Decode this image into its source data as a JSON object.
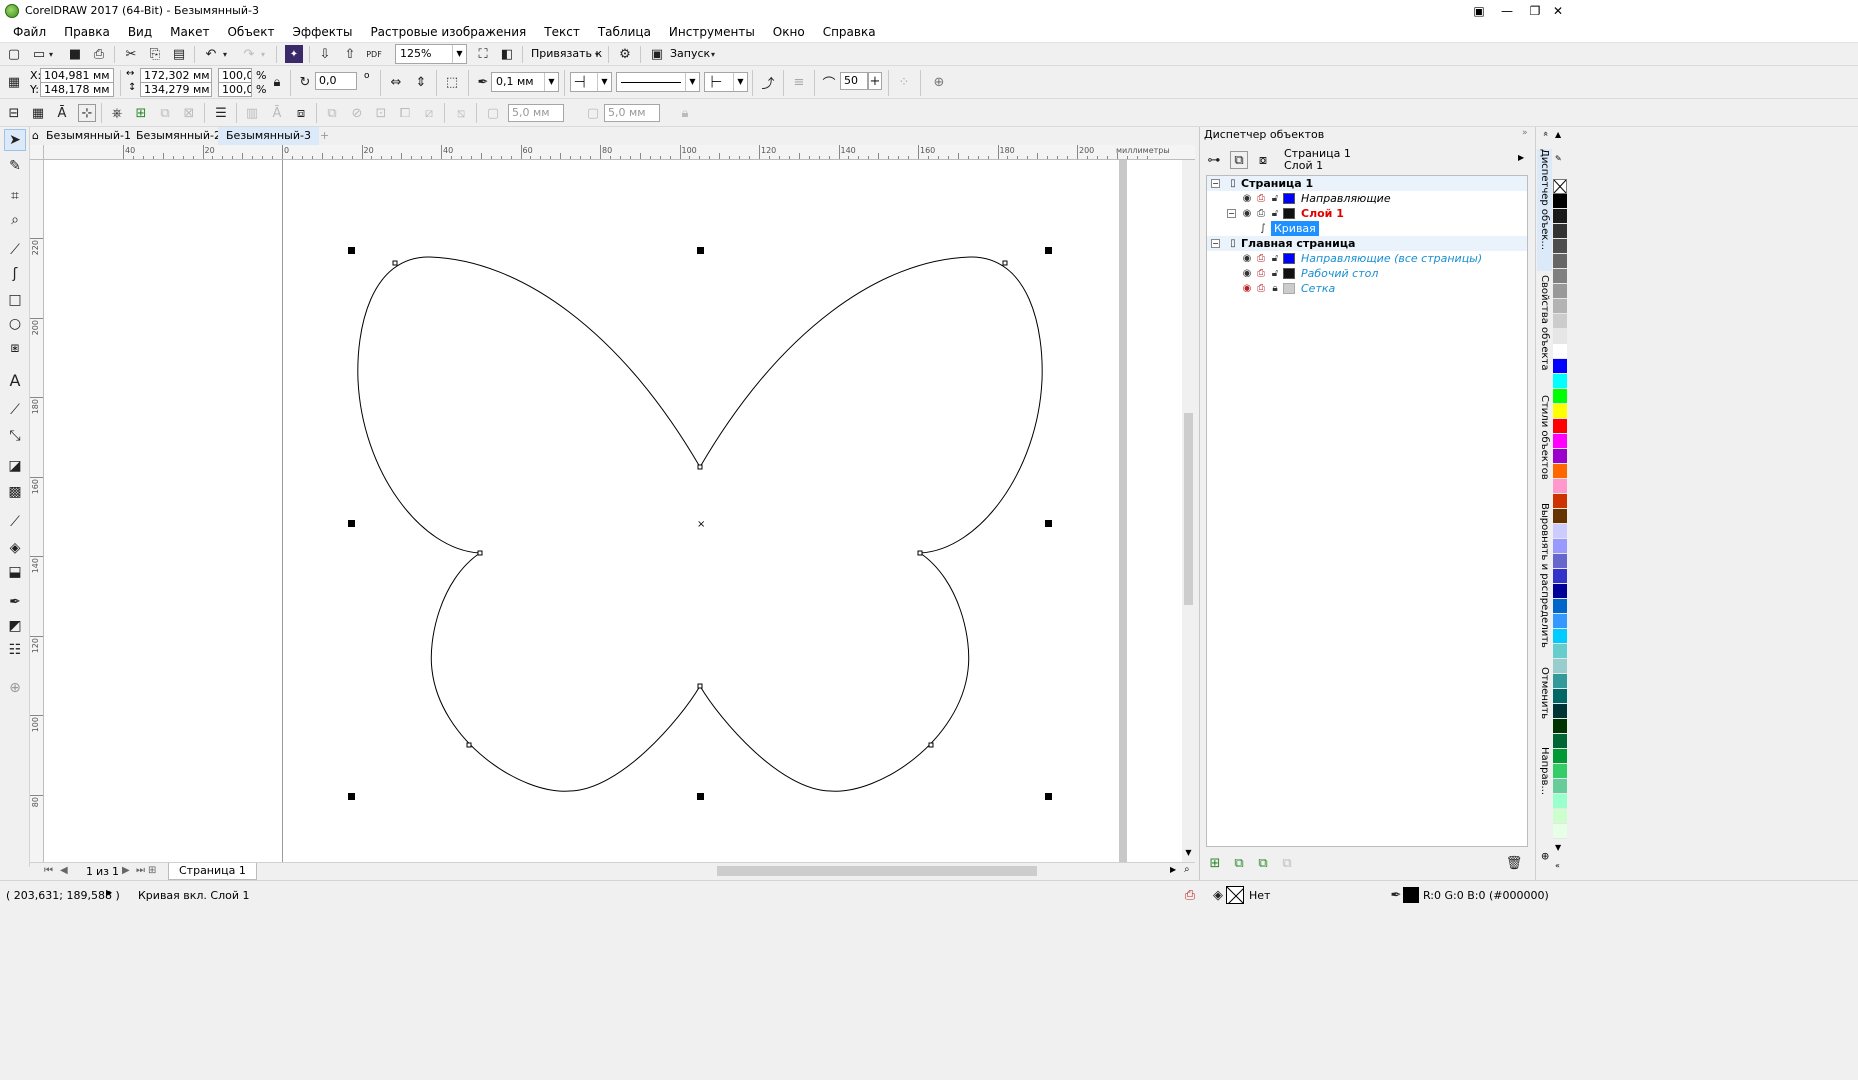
{
  "window": {
    "title": "CorelDRAW 2017 (64-Bit) - Безымянный-3"
  },
  "menu": [
    "Файл",
    "Правка",
    "Вид",
    "Макет",
    "Объект",
    "Эффекты",
    "Растровые изображения",
    "Текст",
    "Таблица",
    "Инструменты",
    "Окно",
    "Справка"
  ],
  "toolbar": {
    "zoom": "125%",
    "snap_label": "Привязать к",
    "launch_label": "Запуск"
  },
  "property_bar": {
    "x_label": "X:",
    "x": "104,981 мм",
    "y_label": "Y:",
    "y": "148,178 мм",
    "width": "172,302 мм",
    "height": "134,279 мм",
    "scale_x": "100,0",
    "scale_y": "100,0",
    "percent": "%",
    "rotation": "0,0",
    "outline_width": "0,1 мм",
    "smoothing": "50"
  },
  "property_bar2": {
    "corner1": "5,0 мм",
    "corner2": "5,0 мм"
  },
  "doc_tabs": [
    "Безымянный-1",
    "Безымянный-2",
    "Безымянный-3"
  ],
  "active_tab": 2,
  "ruler": {
    "h_ticks": [
      "40",
      "20",
      "0",
      "20",
      "40",
      "60",
      "80",
      "100",
      "120",
      "140",
      "160",
      "180",
      "200"
    ],
    "unit": "миллиметры",
    "v_ticks": [
      "220",
      "200",
      "180",
      "160",
      "140",
      "120",
      "100",
      "80"
    ]
  },
  "page_nav": {
    "current": "1",
    "of": "из",
    "total": "1",
    "page_tab": "Страница 1"
  },
  "status": {
    "coords": "( 203,631; 189,588 )",
    "info": "Кривая вкл. Слой 1",
    "fill": "Нет",
    "outline": "R:0 G:0 B:0 (#000000)"
  },
  "object_manager": {
    "title": "Диспетчер объектов",
    "current_page": "Страница 1",
    "current_layer": "Слой 1",
    "tree": [
      {
        "label": "Страница 1",
        "type": "page"
      },
      {
        "label": "Направляющие",
        "type": "layer",
        "color": "#0000ff",
        "style": "italic"
      },
      {
        "label": "Слой 1",
        "type": "layer",
        "color": "#111111",
        "style": "active"
      },
      {
        "label": "Кривая",
        "type": "object",
        "style": "selected"
      },
      {
        "label": "Главная страница",
        "type": "page"
      },
      {
        "label": "Направляющие (все страницы)",
        "type": "layer",
        "color": "#0000ff",
        "style": "master"
      },
      {
        "label": "Рабочий стол",
        "type": "layer",
        "color": "#111111",
        "style": "master"
      },
      {
        "label": "Сетка",
        "type": "layer",
        "color": "#cccccc",
        "style": "master"
      }
    ]
  },
  "side_tabs": [
    "Диспетчер объек...",
    "Свойства объекта",
    "Стили объектов",
    "Выровнять и распределить",
    "Отменить",
    "Направ..."
  ],
  "palette": [
    "#ffffff",
    "#000000",
    "#1a1a1a",
    "#333333",
    "#4d4d4d",
    "#666666",
    "#808080",
    "#999999",
    "#b3b3b3",
    "#cccccc",
    "#e6e6e6",
    "#ffffff",
    "#0000ff",
    "#00ffff",
    "#00ff00",
    "#ffff00",
    "#ff0000",
    "#ff00ff",
    "#9900cc",
    "#ff6600",
    "#ff99cc",
    "#cc3300",
    "#663300",
    "#ccccff",
    "#9999ff",
    "#6666cc",
    "#3333cc",
    "#000099",
    "#0066cc",
    "#3399ff",
    "#00ccff",
    "#66cccc",
    "#99cccc",
    "#339999",
    "#006666",
    "#003333",
    "#003300",
    "#006633",
    "#009933",
    "#33cc66",
    "#66cc99",
    "#99ffcc",
    "#ccffcc",
    "#e6ffe6"
  ],
  "colors": {
    "accent": "#1e90ff",
    "selection_bg": "#1e90ff",
    "active_layer": "#e00000",
    "master_text": "#1a8fd0"
  }
}
